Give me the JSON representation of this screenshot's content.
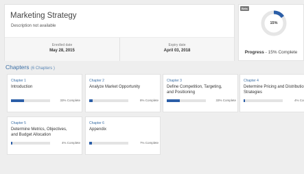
{
  "course": {
    "title": "Marketing Strategy",
    "description": "Description not available",
    "enrolled_label": "Enrolled date",
    "enrolled_value": "May 28, 2015",
    "expiry_label": "Expiry date",
    "expiry_value": "April 03, 2018"
  },
  "progress": {
    "badge": "Beta",
    "percent": 15,
    "percent_label": "15%",
    "caption_bold": "Progress",
    "caption_rest": " - 15% Complete",
    "arc_color": "#2b5ea7",
    "track_color": "#e6e6e6"
  },
  "chapters_section": {
    "heading": "Chapters",
    "count": "(6 Chapters )"
  },
  "chapters": [
    {
      "number": "Chapter 1",
      "title": [
        "Introduction"
      ],
      "complete": 33,
      "complete_label": "33% Complete"
    },
    {
      "number": "Chapter 2",
      "title": [
        "Analyze Market Opportunity"
      ],
      "complete": 8,
      "complete_label": "8% Complete"
    },
    {
      "number": "Chapter 3",
      "title": [
        "Define Competition, Targeting,",
        "and Positioning"
      ],
      "complete": 33,
      "complete_label": "33% Complete"
    },
    {
      "number": "Chapter 4",
      "title": [
        "Determine Pricing and Distribution",
        "Strategies"
      ],
      "complete": 4,
      "complete_label": "4% Complete"
    },
    {
      "number": "Chapter 5",
      "title": [
        "Determine Metrics, Objectives,",
        "and Budget Allocation"
      ],
      "complete": 4,
      "complete_label": "4% Complete"
    },
    {
      "number": "Chapter 6",
      "title": [
        "Appendix"
      ],
      "complete": 7,
      "complete_label": "7% Complete"
    }
  ]
}
